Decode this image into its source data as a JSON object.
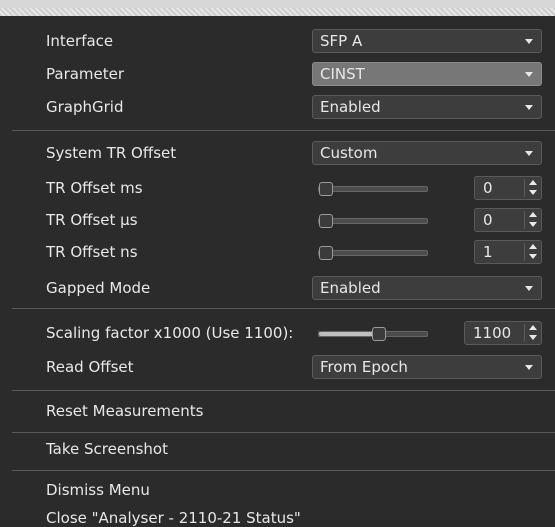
{
  "rows": {
    "interface": {
      "label": "Interface",
      "value": "SFP A"
    },
    "parameter": {
      "label": "Parameter",
      "value": "CINST"
    },
    "graphgrid": {
      "label": "GraphGrid",
      "value": "Enabled"
    },
    "system_tr_offset": {
      "label": "System TR Offset",
      "value": "Custom"
    },
    "tr_offset_ms": {
      "label": "TR Offset ms",
      "value": "0",
      "slider_level": 0
    },
    "tr_offset_us": {
      "label": "TR Offset µs",
      "value": "0",
      "slider_level": 0
    },
    "tr_offset_ns": {
      "label": "TR Offset ns",
      "value": "1",
      "slider_level": 0
    },
    "gapped_mode": {
      "label": "Gapped Mode",
      "value": "Enabled"
    },
    "scaling_factor": {
      "label": "Scaling factor x1000 (Use 1100):",
      "value": "1100",
      "slider_level": 0.55
    },
    "read_offset": {
      "label": "Read Offset",
      "value": "From Epoch"
    }
  },
  "actions": {
    "reset": "Reset Measurements",
    "screenshot": "Take Screenshot",
    "dismiss": "Dismiss Menu",
    "close": "Close \"Analyser - 2110-21 Status\""
  }
}
